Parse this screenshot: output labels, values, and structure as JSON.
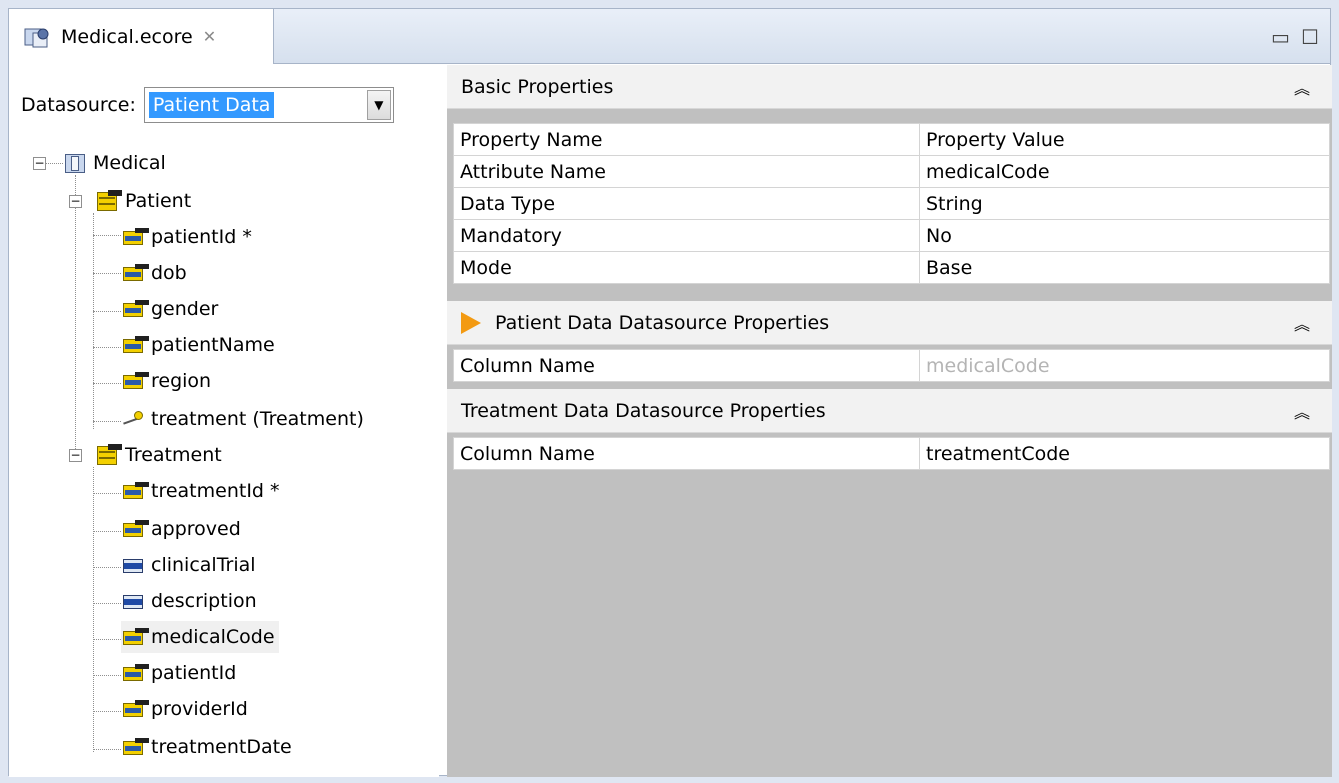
{
  "editor": {
    "tab_label": "Medical.ecore",
    "tab_icon": "ecore-file-icon",
    "close_icon": "close-icon"
  },
  "datasource": {
    "label": "Datasource:",
    "selected": "Patient Data"
  },
  "tree": {
    "root": "Medical",
    "classes": [
      {
        "name": "Patient",
        "attributes": [
          "patientId *",
          "dob",
          "gender",
          "patientName",
          "region"
        ],
        "reference": "treatment (Treatment)"
      },
      {
        "name": "Treatment",
        "attributes": [
          "treatmentId *",
          "approved",
          "clinicalTrial",
          "description",
          "medicalCode",
          "patientId",
          "providerId",
          "treatmentDate"
        ]
      }
    ],
    "selected": "medicalCode"
  },
  "basic": {
    "title": "Basic Properties",
    "header": [
      "Property Name",
      "Property Value"
    ],
    "rows": [
      [
        "Attribute Name",
        "medicalCode"
      ],
      [
        "Data Type",
        "String"
      ],
      [
        "Mandatory",
        "No"
      ],
      [
        "Mode",
        "Base"
      ]
    ]
  },
  "patient_ds": {
    "title": "Patient Data Datasource Properties",
    "rows": [
      [
        "Column Name",
        "medicalCode"
      ]
    ]
  },
  "treatment_ds": {
    "title": "Treatment Data Datasource Properties",
    "rows": [
      [
        "Column Name",
        "treatmentCode"
      ]
    ]
  },
  "colors": {
    "selection": "#3399ff",
    "accent_arrow": "#f39a12",
    "panel_gray": "#c0c0c0"
  }
}
